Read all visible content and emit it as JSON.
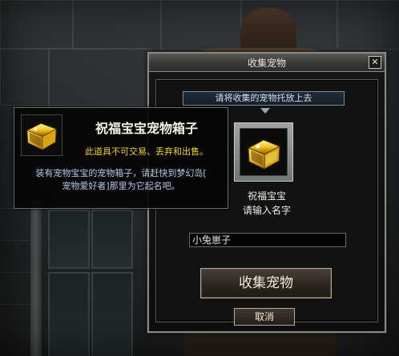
{
  "dialog": {
    "title": "收集宠物",
    "close_icon": "✕",
    "drop_hint": "请将收集的宠物托放上去",
    "pet_name": "祝福宝宝",
    "name_prompt": "请输入名字",
    "name_input_value": "小兔崽子",
    "collect_button": "收集宠物",
    "cancel_button": "取消"
  },
  "tooltip": {
    "title": "祝福宝宝宠物箱子",
    "warning": "此道具不可交易、丢弃和出售。",
    "description_line1": "装有宠物宝宝的宠物箱子，请赶快到梦幻岛[",
    "description_line2": "宠物爱好者]那里为它起名吧。"
  },
  "icons": {
    "item_icon": "gold-treasure-chest-icon",
    "close_icon": "close-icon"
  },
  "colors": {
    "warning_text": "#f0d233",
    "description_text": "#b7c8ea",
    "frame_border": "#8a8a82"
  }
}
